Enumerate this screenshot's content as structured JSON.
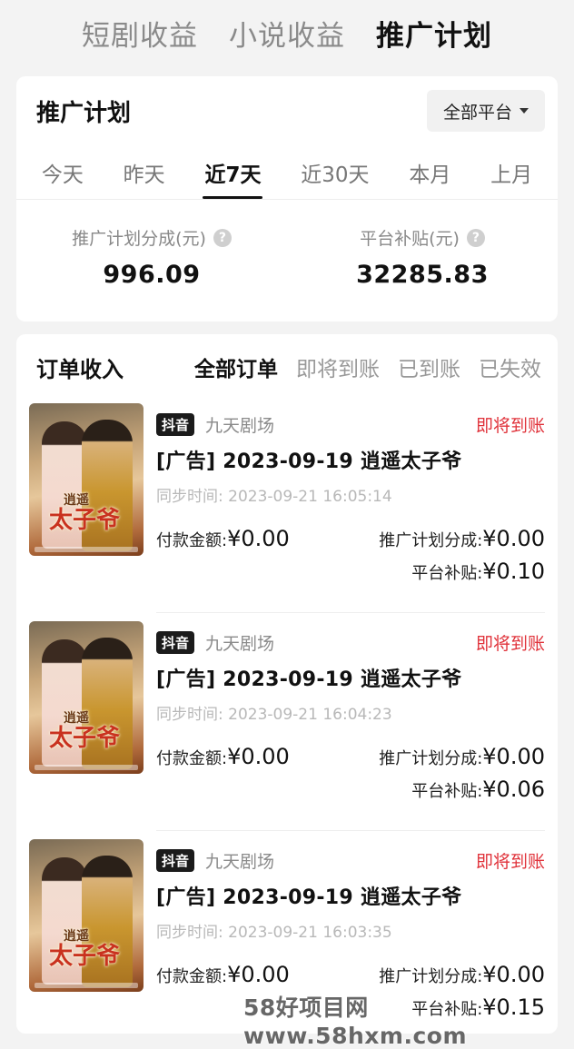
{
  "top_tabs": [
    "短剧收益",
    "小说收益",
    "推广计划"
  ],
  "plan": {
    "title": "推广计划",
    "platform_filter": "全部平台",
    "ranges": [
      "今天",
      "昨天",
      "近7天",
      "近30天",
      "本月",
      "上月"
    ],
    "active_range": "近7天",
    "stats": [
      {
        "label": "推广计划分成(元)",
        "value": "996.09"
      },
      {
        "label": "平台补贴(元)",
        "value": "32285.83"
      }
    ],
    "help_glyph": "?"
  },
  "orders": {
    "title": "订单收入",
    "filters": [
      "全部订单",
      "即将到账",
      "已到账",
      "已失效"
    ],
    "active_filter": "全部订单",
    "poster_title_small": "逍遥",
    "poster_title": "太子爷",
    "items": [
      {
        "platform": "抖音",
        "channel": "九天剧场",
        "status": "即将到账",
        "title": "[广告] 2023-09-19 逍遥太子爷",
        "sync_label": "同步时间:",
        "sync_time": "2023-09-21 16:05:14",
        "pay_label": "付款金额:",
        "pay_value": "¥0.00",
        "share_label": "推广计划分成:",
        "share_value": "¥0.00",
        "subsidy_label": "平台补贴:",
        "subsidy_value": "¥0.10"
      },
      {
        "platform": "抖音",
        "channel": "九天剧场",
        "status": "即将到账",
        "title": "[广告] 2023-09-19 逍遥太子爷",
        "sync_label": "同步时间:",
        "sync_time": "2023-09-21 16:04:23",
        "pay_label": "付款金额:",
        "pay_value": "¥0.00",
        "share_label": "推广计划分成:",
        "share_value": "¥0.00",
        "subsidy_label": "平台补贴:",
        "subsidy_value": "¥0.06"
      },
      {
        "platform": "抖音",
        "channel": "九天剧场",
        "status": "即将到账",
        "title": "[广告] 2023-09-19 逍遥太子爷",
        "sync_label": "同步时间:",
        "sync_time": "2023-09-21 16:03:35",
        "pay_label": "付款金额:",
        "pay_value": "¥0.00",
        "share_label": "推广计划分成:",
        "share_value": "¥0.00",
        "subsidy_label": "平台补贴:",
        "subsidy_value": "¥0.15"
      }
    ]
  },
  "watermark": "58好项目网www.58hxm.com"
}
